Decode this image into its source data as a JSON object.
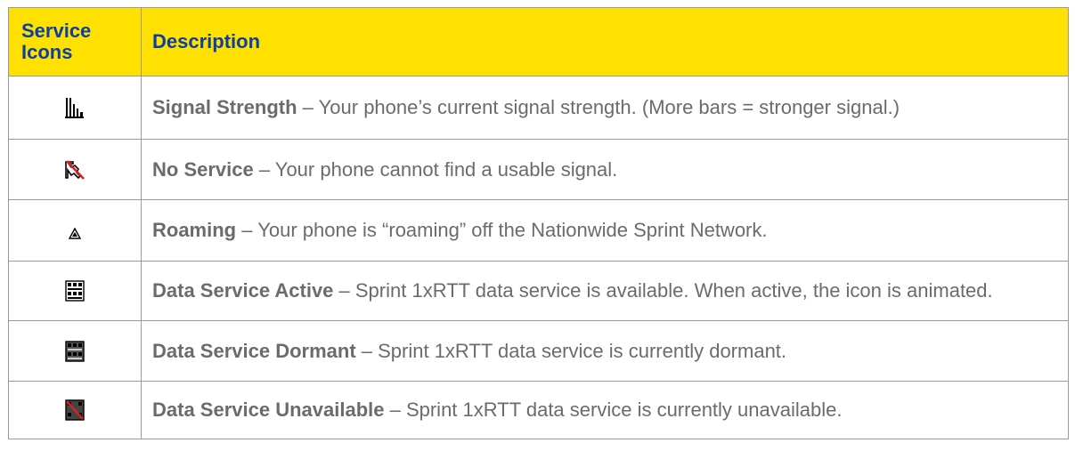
{
  "table": {
    "headers": {
      "icon_col": "Service Icons",
      "desc_col": "Description"
    },
    "rows": [
      {
        "icon": "signal-strength-icon",
        "term": "Signal Strength",
        "text": " – Your phone’s current signal strength. (More bars = stronger signal.)"
      },
      {
        "icon": "no-service-icon",
        "term": "No Service",
        "text": " – Your phone cannot find a usable signal."
      },
      {
        "icon": "roaming-icon",
        "term": "Roaming",
        "text": " – Your phone is “roaming” off the Nationwide Sprint Network."
      },
      {
        "icon": "data-service-active-icon",
        "term": "Data Service Active",
        "text": " – Sprint 1xRTT data service is available. When active, the icon is animated."
      },
      {
        "icon": "data-service-dormant-icon",
        "term": "Data Service Dormant",
        "text": " – Sprint 1xRTT data service is currently dormant."
      },
      {
        "icon": "data-service-unavailable-icon",
        "term": "Data Service Unavailable",
        "text": " – Sprint 1xRTT data service is currently unavailable."
      }
    ]
  },
  "colors": {
    "header_bg": "#ffe100",
    "header_text": "#0b3fa6",
    "body_text": "#6b6b6b",
    "border": "#9a9a9a"
  }
}
